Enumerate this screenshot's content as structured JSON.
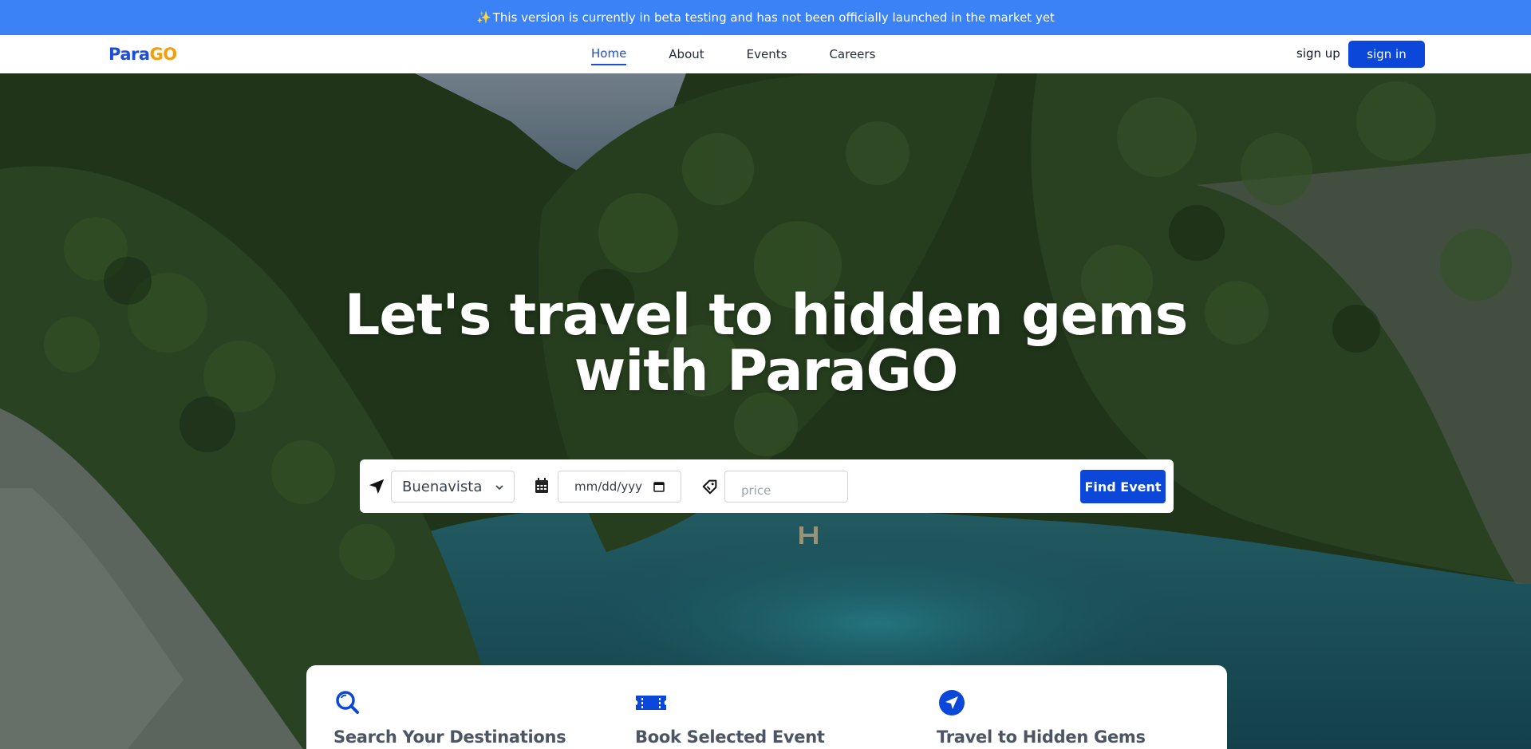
{
  "banner": {
    "text": "This version is currently in beta testing and has not been officially launched in the market yet",
    "icon": "sparkle-icon"
  },
  "navbar": {
    "logo_part1": "Para",
    "logo_part2": "GO",
    "links": [
      {
        "label": "Home",
        "active": true
      },
      {
        "label": "About",
        "active": false
      },
      {
        "label": "Events",
        "active": false
      },
      {
        "label": "Careers",
        "active": false
      }
    ],
    "signup_label": "sign up",
    "signin_label": "sign in"
  },
  "hero": {
    "title_line1": "Let's travel to hidden gems",
    "title_line2": "with ParaGO"
  },
  "search": {
    "location_icon": "navigation-arrow-icon",
    "location_value": "Buenavista",
    "date_icon": "calendar-icon",
    "date_placeholder": "mm/dd/yyy",
    "price_icon": "price-tag-icon",
    "price_placeholder": "price",
    "submit_label": "Find Event"
  },
  "features": [
    {
      "icon": "search-icon",
      "title": "Search Your Destinations"
    },
    {
      "icon": "ticket-icon",
      "title": "Book Selected Event"
    },
    {
      "icon": "navigation-circle-icon",
      "title": "Travel to Hidden Gems"
    }
  ],
  "colors": {
    "banner_bg": "#3b82f6",
    "primary": "#0b47d8",
    "logo_accent": "#f59e0b"
  }
}
